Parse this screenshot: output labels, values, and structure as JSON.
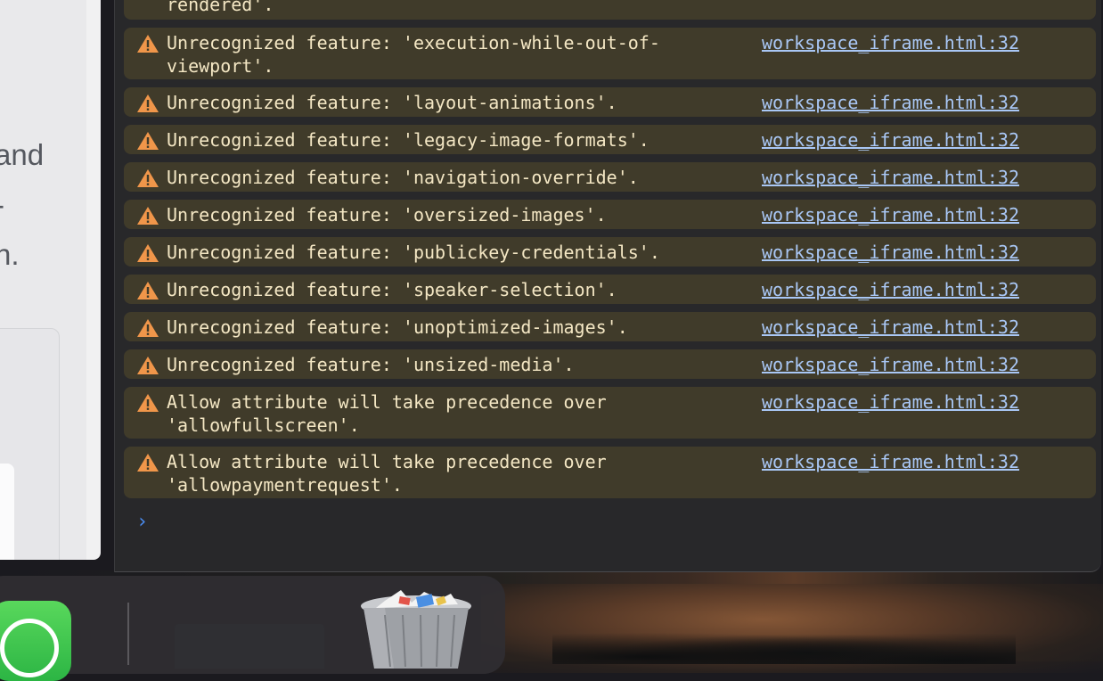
{
  "left_page": {
    "text_lines": [
      "and",
      "-",
      "n."
    ]
  },
  "console": {
    "partial_top_text": "rendered'.",
    "messages": [
      {
        "text": "Unrecognized feature: 'execution-while-out-of-viewport'.",
        "line1": "Unrecognized feature: 'execution-while-out-of-",
        "line2": "viewport'.",
        "source": "workspace_iframe.html:32"
      },
      {
        "text": "Unrecognized feature: 'layout-animations'.",
        "source": "workspace_iframe.html:32"
      },
      {
        "text": "Unrecognized feature: 'legacy-image-formats'.",
        "source": "workspace_iframe.html:32"
      },
      {
        "text": "Unrecognized feature: 'navigation-override'.",
        "source": "workspace_iframe.html:32"
      },
      {
        "text": "Unrecognized feature: 'oversized-images'.",
        "source": "workspace_iframe.html:32"
      },
      {
        "text": "Unrecognized feature: 'publickey-credentials'.",
        "source": "workspace_iframe.html:32"
      },
      {
        "text": "Unrecognized feature: 'speaker-selection'.",
        "source": "workspace_iframe.html:32"
      },
      {
        "text": "Unrecognized feature: 'unoptimized-images'.",
        "source": "workspace_iframe.html:32"
      },
      {
        "text": "Unrecognized feature: 'unsized-media'.",
        "source": "workspace_iframe.html:32"
      },
      {
        "text": "Allow attribute will take precedence over 'allowfullscreen'.",
        "line1": "Allow attribute will take precedence over",
        "line2": "'allowfullscreen'.",
        "source": "workspace_iframe.html:32"
      },
      {
        "text": "Allow attribute will take precedence over 'allowpaymentrequest'.",
        "line1": "Allow attribute will take precedence over",
        "line2": "'allowpaymentrequest'.",
        "source": "workspace_iframe.html:32"
      }
    ],
    "prompt_symbol": "›"
  },
  "dock": {
    "items": [
      "messages-app-icon",
      "window-thumbnail",
      "trash-icon"
    ]
  },
  "colors": {
    "warning_bg": "#403b2a",
    "warning_text": "#f4e7c4",
    "link": "#a9c7f5",
    "warning_icon": "#f0964a",
    "console_bg": "#28282a"
  }
}
